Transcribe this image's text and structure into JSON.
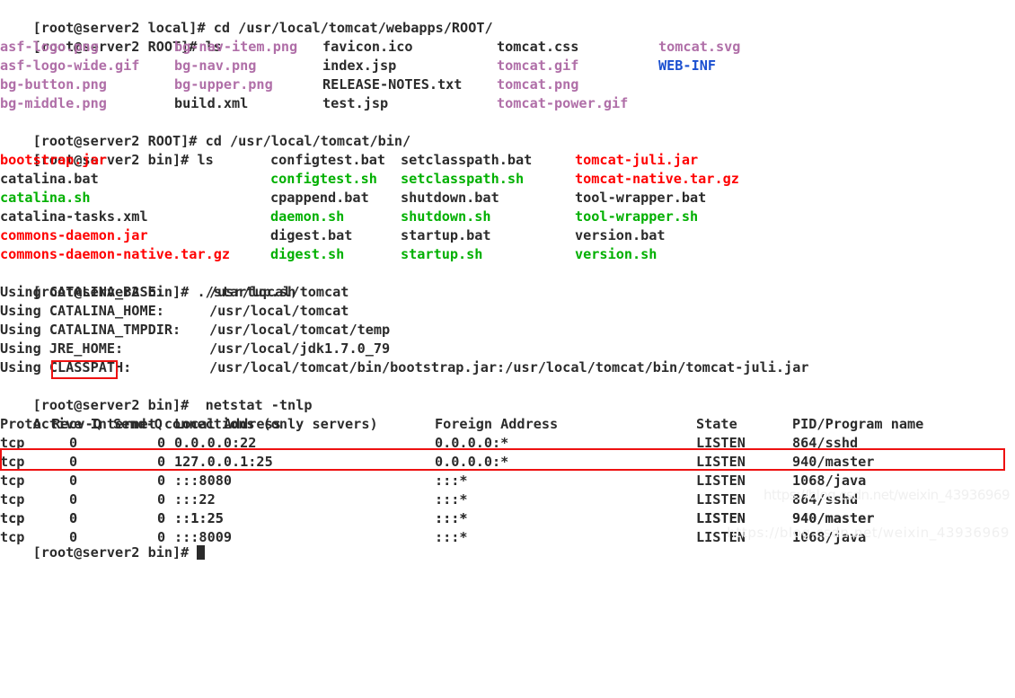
{
  "terminal": {
    "user": "root",
    "host": "server2",
    "colors": {
      "background": "#ffffff",
      "foreground": "#2b2b2b",
      "image": "#b06fa8",
      "directory": "#1a4fd0",
      "executable": "#00b000",
      "archive": "#ff0000",
      "annotation": "#ee1111",
      "watermark": "#f0f0f0"
    },
    "prompts": {
      "local": "[root@server2 local]# ",
      "root_dir": "[root@server2 ROOT]# ",
      "bin": "[root@server2 bin]# ",
      "bin_wide": "[root@server2 bin]#  "
    },
    "commands": {
      "cd_webapps_root": "cd /usr/local/tomcat/webapps/ROOT/",
      "ls": "ls",
      "cd_bin": "cd /usr/local/tomcat/bin/",
      "startup": "./startup.sh",
      "netstat": "netstat -tnlp"
    },
    "prompt_parts": {
      "open": "[",
      "user_at": "root@",
      "host": "server2",
      "space_local": " local]# ",
      "space_bin": " bin]#  "
    },
    "ls_root": {
      "col1": [
        {
          "name": "asf-logo.png",
          "type": "image"
        },
        {
          "name": "asf-logo-wide.gif",
          "type": "image"
        },
        {
          "name": "bg-button.png",
          "type": "image"
        },
        {
          "name": "bg-middle.png",
          "type": "image"
        }
      ],
      "col2": [
        {
          "name": "bg-nav-item.png",
          "type": "image"
        },
        {
          "name": "bg-nav.png",
          "type": "image"
        },
        {
          "name": "bg-upper.png",
          "type": "image"
        },
        {
          "name": "build.xml",
          "type": "normal"
        }
      ],
      "col3": [
        {
          "name": "favicon.ico",
          "type": "normal"
        },
        {
          "name": "index.jsp",
          "type": "normal"
        },
        {
          "name": "RELEASE-NOTES.txt",
          "type": "normal"
        },
        {
          "name": "test.jsp",
          "type": "normal"
        }
      ],
      "col4": [
        {
          "name": "tomcat.css",
          "type": "normal"
        },
        {
          "name": "tomcat.gif",
          "type": "image"
        },
        {
          "name": "tomcat.png",
          "type": "image"
        },
        {
          "name": "tomcat-power.gif",
          "type": "image"
        }
      ],
      "col5": [
        {
          "name": "tomcat.svg",
          "type": "image"
        },
        {
          "name": "WEB-INF",
          "type": "directory"
        }
      ]
    },
    "ls_bin": {
      "col1": [
        {
          "name": "bootstrap.jar",
          "type": "archive"
        },
        {
          "name": "catalina.bat",
          "type": "normal"
        },
        {
          "name": "catalina.sh",
          "type": "executable"
        },
        {
          "name": "catalina-tasks.xml",
          "type": "normal"
        },
        {
          "name": "commons-daemon.jar",
          "type": "archive"
        },
        {
          "name": "commons-daemon-native.tar.gz",
          "type": "archive"
        }
      ],
      "col2": [
        {
          "name": "configtest.bat",
          "type": "normal"
        },
        {
          "name": "configtest.sh",
          "type": "executable"
        },
        {
          "name": "cpappend.bat",
          "type": "normal"
        },
        {
          "name": "daemon.sh",
          "type": "executable"
        },
        {
          "name": "digest.bat",
          "type": "normal"
        },
        {
          "name": "digest.sh",
          "type": "executable"
        }
      ],
      "col3": [
        {
          "name": "setclasspath.bat",
          "type": "normal"
        },
        {
          "name": "setclasspath.sh",
          "type": "executable"
        },
        {
          "name": "shutdown.bat",
          "type": "normal"
        },
        {
          "name": "shutdown.sh",
          "type": "executable"
        },
        {
          "name": "startup.bat",
          "type": "normal"
        },
        {
          "name": "startup.sh",
          "type": "executable"
        }
      ],
      "col4": [
        {
          "name": "tomcat-juli.jar",
          "type": "archive"
        },
        {
          "name": "tomcat-native.tar.gz",
          "type": "archive"
        },
        {
          "name": "tool-wrapper.bat",
          "type": "normal"
        },
        {
          "name": "tool-wrapper.sh",
          "type": "executable"
        },
        {
          "name": "version.bat",
          "type": "normal"
        },
        {
          "name": "version.sh",
          "type": "executable"
        }
      ]
    },
    "startup_output": [
      {
        "label": "Using CATALINA_BASE:",
        "value": "/usr/local/tomcat"
      },
      {
        "label": "Using CATALINA_HOME:",
        "value": "/usr/local/tomcat"
      },
      {
        "label": "Using CATALINA_TMPDIR:",
        "value": "/usr/local/tomcat/temp"
      },
      {
        "label": "Using JRE_HOME:",
        "value": "/usr/local/jdk1.7.0_79"
      },
      {
        "label": "Using CLASSPATH:",
        "value": "/usr/local/tomcat/bin/bootstrap.jar:/usr/local/tomcat/bin/tomcat-juli.jar"
      }
    ],
    "netstat": {
      "heading": "Active Internet connections (only servers)",
      "headers": {
        "proto": "Proto",
        "recvq": "Recv-Q",
        "sendq": "Send-Q",
        "local": "Local Address",
        "foreign": "Foreign Address",
        "state": "State",
        "pid": "PID/Program name"
      },
      "rows": [
        {
          "proto": "tcp",
          "recvq": "0",
          "sendq": "0",
          "local": "0.0.0.0:22",
          "foreign": "0.0.0.0:*",
          "state": "LISTEN",
          "pid": "864/sshd",
          "highlight": false
        },
        {
          "proto": "tcp",
          "recvq": "0",
          "sendq": "0",
          "local": "127.0.0.1:25",
          "foreign": "0.0.0.0:*",
          "state": "LISTEN",
          "pid": "940/master",
          "highlight": false
        },
        {
          "proto": "tcp",
          "recvq": "0",
          "sendq": "0",
          "local": ":::8080",
          "foreign": ":::*",
          "state": "LISTEN",
          "pid": "1068/java",
          "highlight": true
        },
        {
          "proto": "tcp",
          "recvq": "0",
          "sendq": "0",
          "local": ":::22",
          "foreign": ":::*",
          "state": "LISTEN",
          "pid": "864/sshd",
          "highlight": false
        },
        {
          "proto": "tcp",
          "recvq": "0",
          "sendq": "0",
          "local": "::1:25",
          "foreign": ":::*",
          "state": "LISTEN",
          "pid": "940/master",
          "highlight": false
        },
        {
          "proto": "tcp",
          "recvq": "0",
          "sendq": "0",
          "local": ":::8009",
          "foreign": ":::*",
          "state": "LISTEN",
          "pid": "1068/java",
          "highlight": false
        }
      ]
    },
    "watermark": {
      "line1": "https://blog.csdn.net/weixin_43936969",
      "line2": "https://blog.csdn.net/weixin_43936969"
    }
  }
}
